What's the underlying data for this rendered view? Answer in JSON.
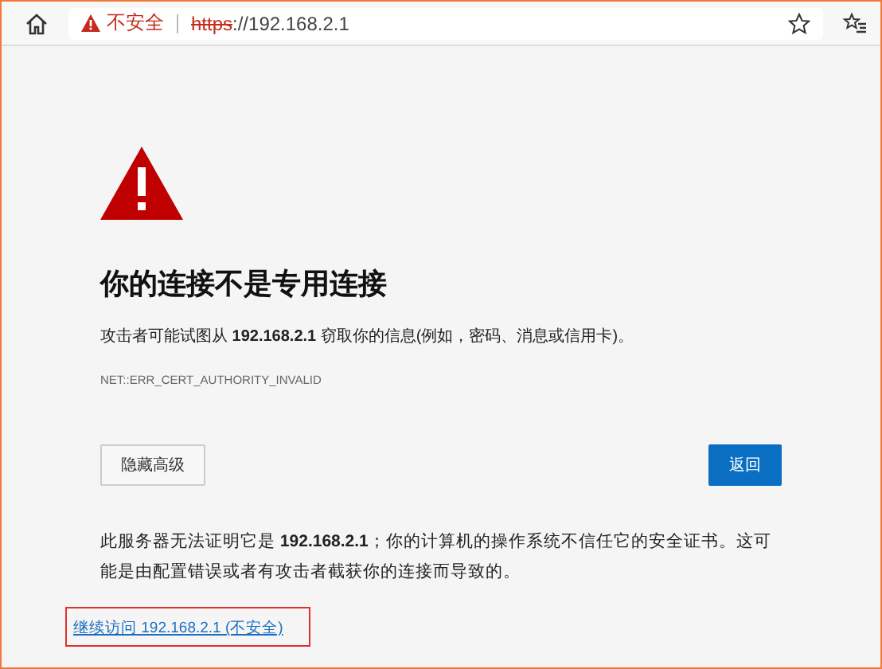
{
  "toolbar": {
    "security_label": "不安全",
    "url_scheme": "https",
    "url_rest": "://192.168.2.1"
  },
  "page": {
    "title": "你的连接不是专用连接",
    "description": "攻击者可能试图从 **192.168.2.1** 窃取你的信息(例如，密码、消息或信用卡)。",
    "error_code": "NET::ERR_CERT_AUTHORITY_INVALID",
    "buttons": [
      {
        "label": "隐藏高级",
        "kind": "secondary"
      },
      {
        "label": "返回",
        "kind": "primary"
      }
    ],
    "details": "此服务器无法证明它是 **192.168.2.1**；你的计算机的操作系统不信任它的安全证书。这可能是由配置错误或者有攻击者截获你的连接而导致的。",
    "proceed_link": "继续访问 192.168.2.1 (不安全)"
  }
}
